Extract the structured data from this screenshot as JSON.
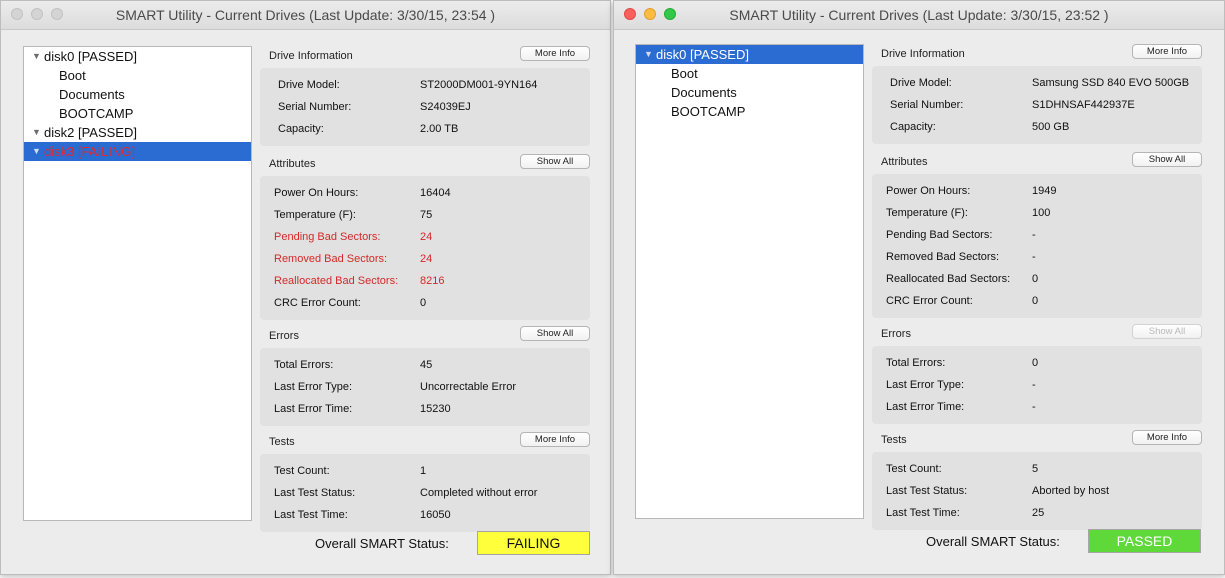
{
  "windows": [
    {
      "title": "SMART Utility - Current Drives (Last Update: 3/30/15, 23:54 )",
      "drives": [
        {
          "label": "disk0  [PASSED]",
          "type": "disk",
          "state": "normal"
        },
        {
          "label": "Boot",
          "type": "vol",
          "state": "normal"
        },
        {
          "label": "Documents",
          "type": "vol",
          "state": "normal"
        },
        {
          "label": "BOOTCAMP",
          "type": "vol",
          "state": "normal"
        },
        {
          "label": "disk2  [PASSED]",
          "type": "disk",
          "state": "normal"
        },
        {
          "label": "disk3  [FAILING]",
          "type": "disk",
          "state": "selected-failing"
        }
      ],
      "drive_info": {
        "heading": "Drive Information",
        "button": "More Info",
        "rows": [
          {
            "k": "Drive Model:",
            "v": "ST2000DM001-9YN164"
          },
          {
            "k": "Serial Number:",
            "v": "S24039EJ"
          },
          {
            "k": "Capacity:",
            "v": "2.00 TB"
          }
        ]
      },
      "attributes": {
        "heading": "Attributes",
        "button": "Show All",
        "rows": [
          {
            "k": "Power On Hours:",
            "v": "16404",
            "bad": false
          },
          {
            "k": "Temperature (F):",
            "v": "75",
            "bad": false
          },
          {
            "k": "Pending Bad Sectors:",
            "v": "24",
            "bad": true
          },
          {
            "k": "Removed Bad Sectors:",
            "v": "24",
            "bad": true
          },
          {
            "k": "Reallocated Bad Sectors:",
            "v": "8216",
            "bad": true
          },
          {
            "k": "CRC Error Count:",
            "v": "0",
            "bad": false
          }
        ]
      },
      "errors": {
        "heading": "Errors",
        "button": "Show All",
        "button_disabled": false,
        "rows": [
          {
            "k": "Total Errors:",
            "v": "45"
          },
          {
            "k": "Last Error Type:",
            "v": "Uncorrectable Error"
          },
          {
            "k": "Last Error Time:",
            "v": "15230"
          }
        ]
      },
      "tests": {
        "heading": "Tests",
        "button": "More Info",
        "rows": [
          {
            "k": "Test Count:",
            "v": "1"
          },
          {
            "k": "Last Test Status:",
            "v": "Completed without error"
          },
          {
            "k": "Last Test Time:",
            "v": "16050"
          }
        ]
      },
      "overall": {
        "label": "Overall SMART Status:",
        "status": "FAILING",
        "color": "#ffff3c"
      }
    },
    {
      "title": "SMART Utility - Current Drives (Last Update: 3/30/15, 23:52 )",
      "drives": [
        {
          "label": "disk0  [PASSED]",
          "type": "disk",
          "state": "selected"
        },
        {
          "label": "Boot",
          "type": "vol",
          "state": "normal"
        },
        {
          "label": "Documents",
          "type": "vol",
          "state": "normal"
        },
        {
          "label": "BOOTCAMP",
          "type": "vol",
          "state": "normal"
        }
      ],
      "drive_info": {
        "heading": "Drive Information",
        "button": "More Info",
        "rows": [
          {
            "k": "Drive Model:",
            "v": "Samsung SSD 840 EVO 500GB"
          },
          {
            "k": "Serial Number:",
            "v": "S1DHNSAF442937E"
          },
          {
            "k": "Capacity:",
            "v": "500 GB"
          }
        ]
      },
      "attributes": {
        "heading": "Attributes",
        "button": "Show All",
        "rows": [
          {
            "k": "Power On Hours:",
            "v": "1949",
            "bad": false
          },
          {
            "k": "Temperature (F):",
            "v": "100",
            "bad": false
          },
          {
            "k": "Pending Bad Sectors:",
            "v": "-",
            "bad": false
          },
          {
            "k": "Removed Bad Sectors:",
            "v": "-",
            "bad": false
          },
          {
            "k": "Reallocated Bad Sectors:",
            "v": "0",
            "bad": false
          },
          {
            "k": "CRC Error Count:",
            "v": "0",
            "bad": false
          }
        ]
      },
      "errors": {
        "heading": "Errors",
        "button": "Show All",
        "button_disabled": true,
        "rows": [
          {
            "k": "Total Errors:",
            "v": "0"
          },
          {
            "k": "Last Error Type:",
            "v": "-"
          },
          {
            "k": "Last Error Time:",
            "v": "-"
          }
        ]
      },
      "tests": {
        "heading": "Tests",
        "button": "More Info",
        "rows": [
          {
            "k": "Test Count:",
            "v": "5"
          },
          {
            "k": "Last Test Status:",
            "v": "Aborted by host"
          },
          {
            "k": "Last Test Time:",
            "v": "25"
          }
        ]
      },
      "overall": {
        "label": "Overall SMART Status:",
        "status": "PASSED",
        "color": "#5fd83a"
      }
    }
  ]
}
